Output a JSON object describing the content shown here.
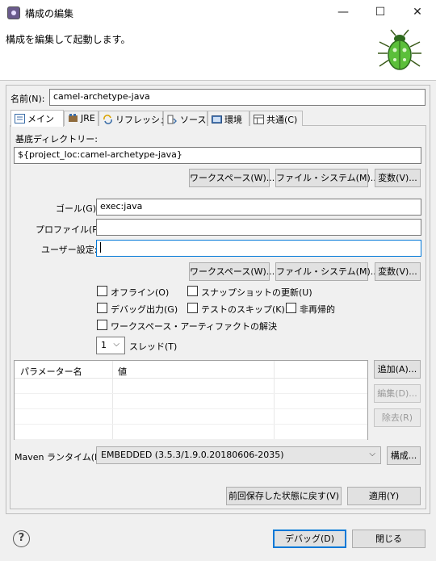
{
  "window": {
    "title": "構成の編集",
    "minimize_glyph": "—",
    "maximize_glyph": "☐",
    "close_glyph": "✕"
  },
  "header": {
    "message": "構成を編集して起動します。"
  },
  "name": {
    "label": "名前(N):",
    "value": "camel-archetype-java"
  },
  "tabs": [
    {
      "label": "メイン",
      "icon": "main-tab-icon"
    },
    {
      "label": "JRE",
      "icon": "jre-icon"
    },
    {
      "label": "リフレッシュ",
      "icon": "refresh-icon"
    },
    {
      "label": "ソース",
      "icon": "source-icon"
    },
    {
      "label": "環境",
      "icon": "environment-icon"
    },
    {
      "label": "共通(C)",
      "icon": "common-icon"
    }
  ],
  "main": {
    "basedir_label": "基底ディレクトリー:",
    "basedir_value": "${project_loc:camel-archetype-java}",
    "workspace_btn": "ワークスペース(W)...",
    "filesystem_btn": "ファイル・システム(M)...",
    "variables_btn": "変数(V)...",
    "goals_label": "ゴール(G):",
    "goals_value": "exec:java",
    "profiles_label": "プロファイル(P):",
    "profiles_value": "",
    "usersettings_label": "ユーザー設定:",
    "usersettings_value": "",
    "offline": "オフライン(O)",
    "update_snapshots": "スナップショットの更新(U)",
    "debug_output": "デバッグ出力(G)",
    "skip_tests": "テストのスキップ(K)",
    "non_recursive": "非再帰的",
    "resolve_workspace": "ワークスペース・アーティファクトの解決",
    "threads_value": "1",
    "threads_label": "スレッド(T)",
    "param_col_name": "パラメーター名",
    "param_col_value": "値",
    "add_btn": "追加(A)...",
    "edit_btn": "編集(D)...",
    "remove_btn": "除去(R)",
    "runtime_label": "Maven ランタイム(I):",
    "runtime_value": "EMBEDDED (3.5.3/1.9.0.20180606-2035)",
    "configure_btn": "構成..."
  },
  "footer": {
    "revert_btn": "前回保存した状態に戻す(V)",
    "apply_btn": "適用(Y)",
    "help_glyph": "?",
    "debug_btn": "デバッグ(D)",
    "close_btn": "閉じる"
  }
}
